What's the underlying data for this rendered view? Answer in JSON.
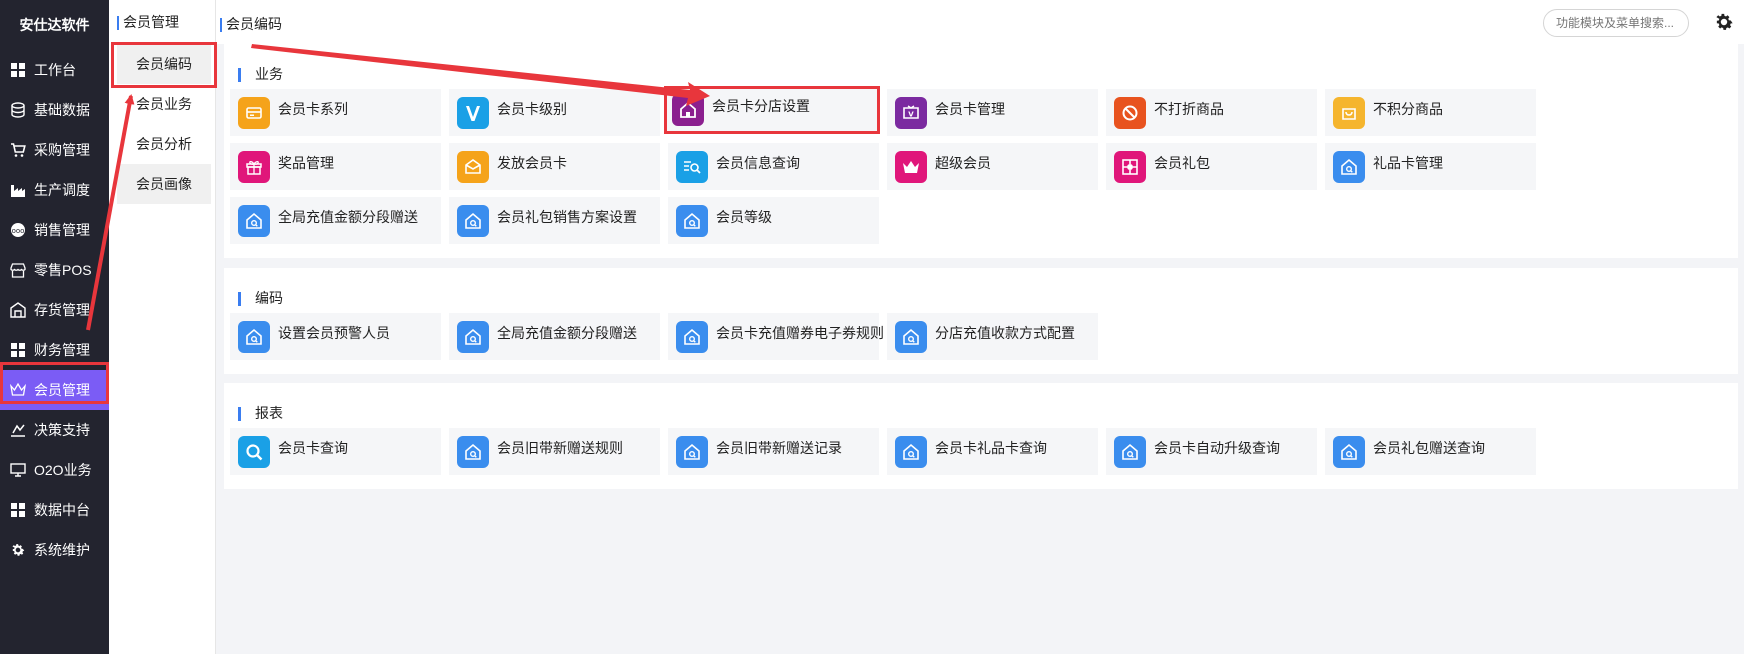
{
  "brand": "安仕达软件",
  "sidebar": {
    "items": [
      {
        "label": "工作台",
        "icon": "grid-icon"
      },
      {
        "label": "基础数据",
        "icon": "database-icon"
      },
      {
        "label": "采购管理",
        "icon": "cart-icon"
      },
      {
        "label": "生产调度",
        "icon": "factory-icon"
      },
      {
        "label": "销售管理",
        "icon": "sales-icon"
      },
      {
        "label": "零售POS",
        "icon": "store-icon"
      },
      {
        "label": "存货管理",
        "icon": "warehouse-icon"
      },
      {
        "label": "财务管理",
        "icon": "grid-icon"
      },
      {
        "label": "会员管理",
        "icon": "crown-icon",
        "active": true
      },
      {
        "label": "决策支持",
        "icon": "chart-icon"
      },
      {
        "label": "O2O业务",
        "icon": "monitor-icon"
      },
      {
        "label": "数据中台",
        "icon": "grid-icon"
      },
      {
        "label": "系统维护",
        "icon": "gear-icon"
      }
    ]
  },
  "submenu": {
    "title": "会员管理",
    "items": [
      "会员编码",
      "会员业务",
      "会员分析",
      "会员画像"
    ]
  },
  "topbar": {
    "breadcrumb": "会员编码",
    "search_placeholder": "功能模块及菜单搜索..."
  },
  "colors": {
    "accent": "#7b5cf5",
    "highlight": "#e8363c",
    "sidebar_bg": "#23242f",
    "link_blue": "#3a7df0"
  },
  "sections": [
    {
      "title": "业务",
      "tiles": [
        {
          "label": "会员卡系列",
          "icon": "card-icon",
          "color": "#f5a31a"
        },
        {
          "label": "会员卡级别",
          "icon": "v-icon",
          "color": "#1aa0e6"
        },
        {
          "label": "会员卡分店设置",
          "icon": "home-icon",
          "color": "#8b1f8f",
          "highlighted": true
        },
        {
          "label": "会员卡管理",
          "icon": "v-screen-icon",
          "color": "#7b2aa0"
        },
        {
          "label": "不打折商品",
          "icon": "no-icon",
          "color": "#e8531f"
        },
        {
          "label": "不积分商品",
          "icon": "bag-icon",
          "color": "#f5b52e"
        },
        {
          "label": "奖品管理",
          "icon": "gift-icon",
          "color": "#e0167a"
        },
        {
          "label": "发放会员卡",
          "icon": "send-card-icon",
          "color": "#f5a31a"
        },
        {
          "label": "会员信息查询",
          "icon": "search-list-icon",
          "color": "#1aa0e6"
        },
        {
          "label": "超级会员",
          "icon": "crown-icon",
          "color": "#e0167a"
        },
        {
          "label": "会员礼包",
          "icon": "package-icon",
          "color": "#e0167a"
        },
        {
          "label": "礼品卡管理",
          "icon": "home-search-icon",
          "color": "#3a8dee"
        },
        {
          "label": "全局充值金额分段赠送",
          "icon": "home-search-icon",
          "color": "#3a8dee"
        },
        {
          "label": "会员礼包销售方案设置",
          "icon": "home-search-icon",
          "color": "#3a8dee"
        },
        {
          "label": "会员等级",
          "icon": "home-search-icon",
          "color": "#3a8dee"
        }
      ]
    },
    {
      "title": "编码",
      "tiles": [
        {
          "label": "设置会员预警人员",
          "icon": "home-search-icon",
          "color": "#3a8dee"
        },
        {
          "label": "全局充值金额分段赠送",
          "icon": "home-search-icon",
          "color": "#3a8dee"
        },
        {
          "label": "会员卡充值赠券电子券规则",
          "icon": "home-search-icon",
          "color": "#3a8dee"
        },
        {
          "label": "分店充值收款方式配置",
          "icon": "home-search-icon",
          "color": "#3a8dee"
        }
      ]
    },
    {
      "title": "报表",
      "tiles": [
        {
          "label": "会员卡查询",
          "icon": "search-icon",
          "color": "#1aa0e6"
        },
        {
          "label": "会员旧带新赠送规则",
          "icon": "home-search-icon",
          "color": "#3a8dee"
        },
        {
          "label": "会员旧带新赠送记录",
          "icon": "home-search-icon",
          "color": "#3a8dee"
        },
        {
          "label": "会员卡礼品卡查询",
          "icon": "home-search-icon",
          "color": "#3a8dee"
        },
        {
          "label": "会员卡自动升级查询",
          "icon": "home-search-icon",
          "color": "#3a8dee"
        },
        {
          "label": "会员礼包赠送查询",
          "icon": "home-search-icon",
          "color": "#3a8dee"
        }
      ]
    }
  ]
}
